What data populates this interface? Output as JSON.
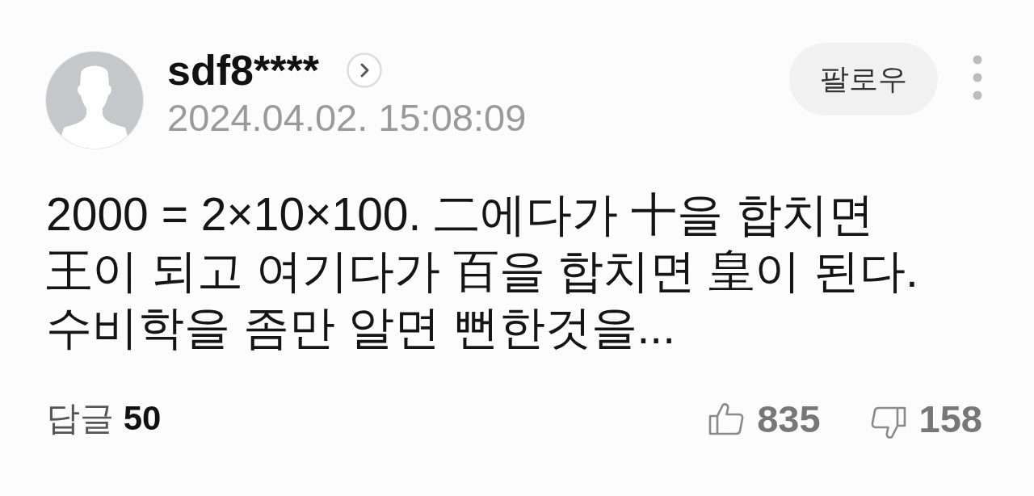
{
  "comment": {
    "author": {
      "name": "sdf8****",
      "timestamp": "2024.04.02. 15:08:09"
    },
    "follow_button": {
      "label": "팔로우"
    },
    "body": "2000 = 2×10×100. 二에다가 十을 합치면\n王이 되고 여기다가 百을 합치면 皇이 된다.\n수비학을 좀만 알면 뻔한것을...",
    "replies": {
      "label": "답글",
      "count": "50"
    },
    "likes": {
      "count": "835"
    },
    "dislikes": {
      "count": "158"
    }
  }
}
